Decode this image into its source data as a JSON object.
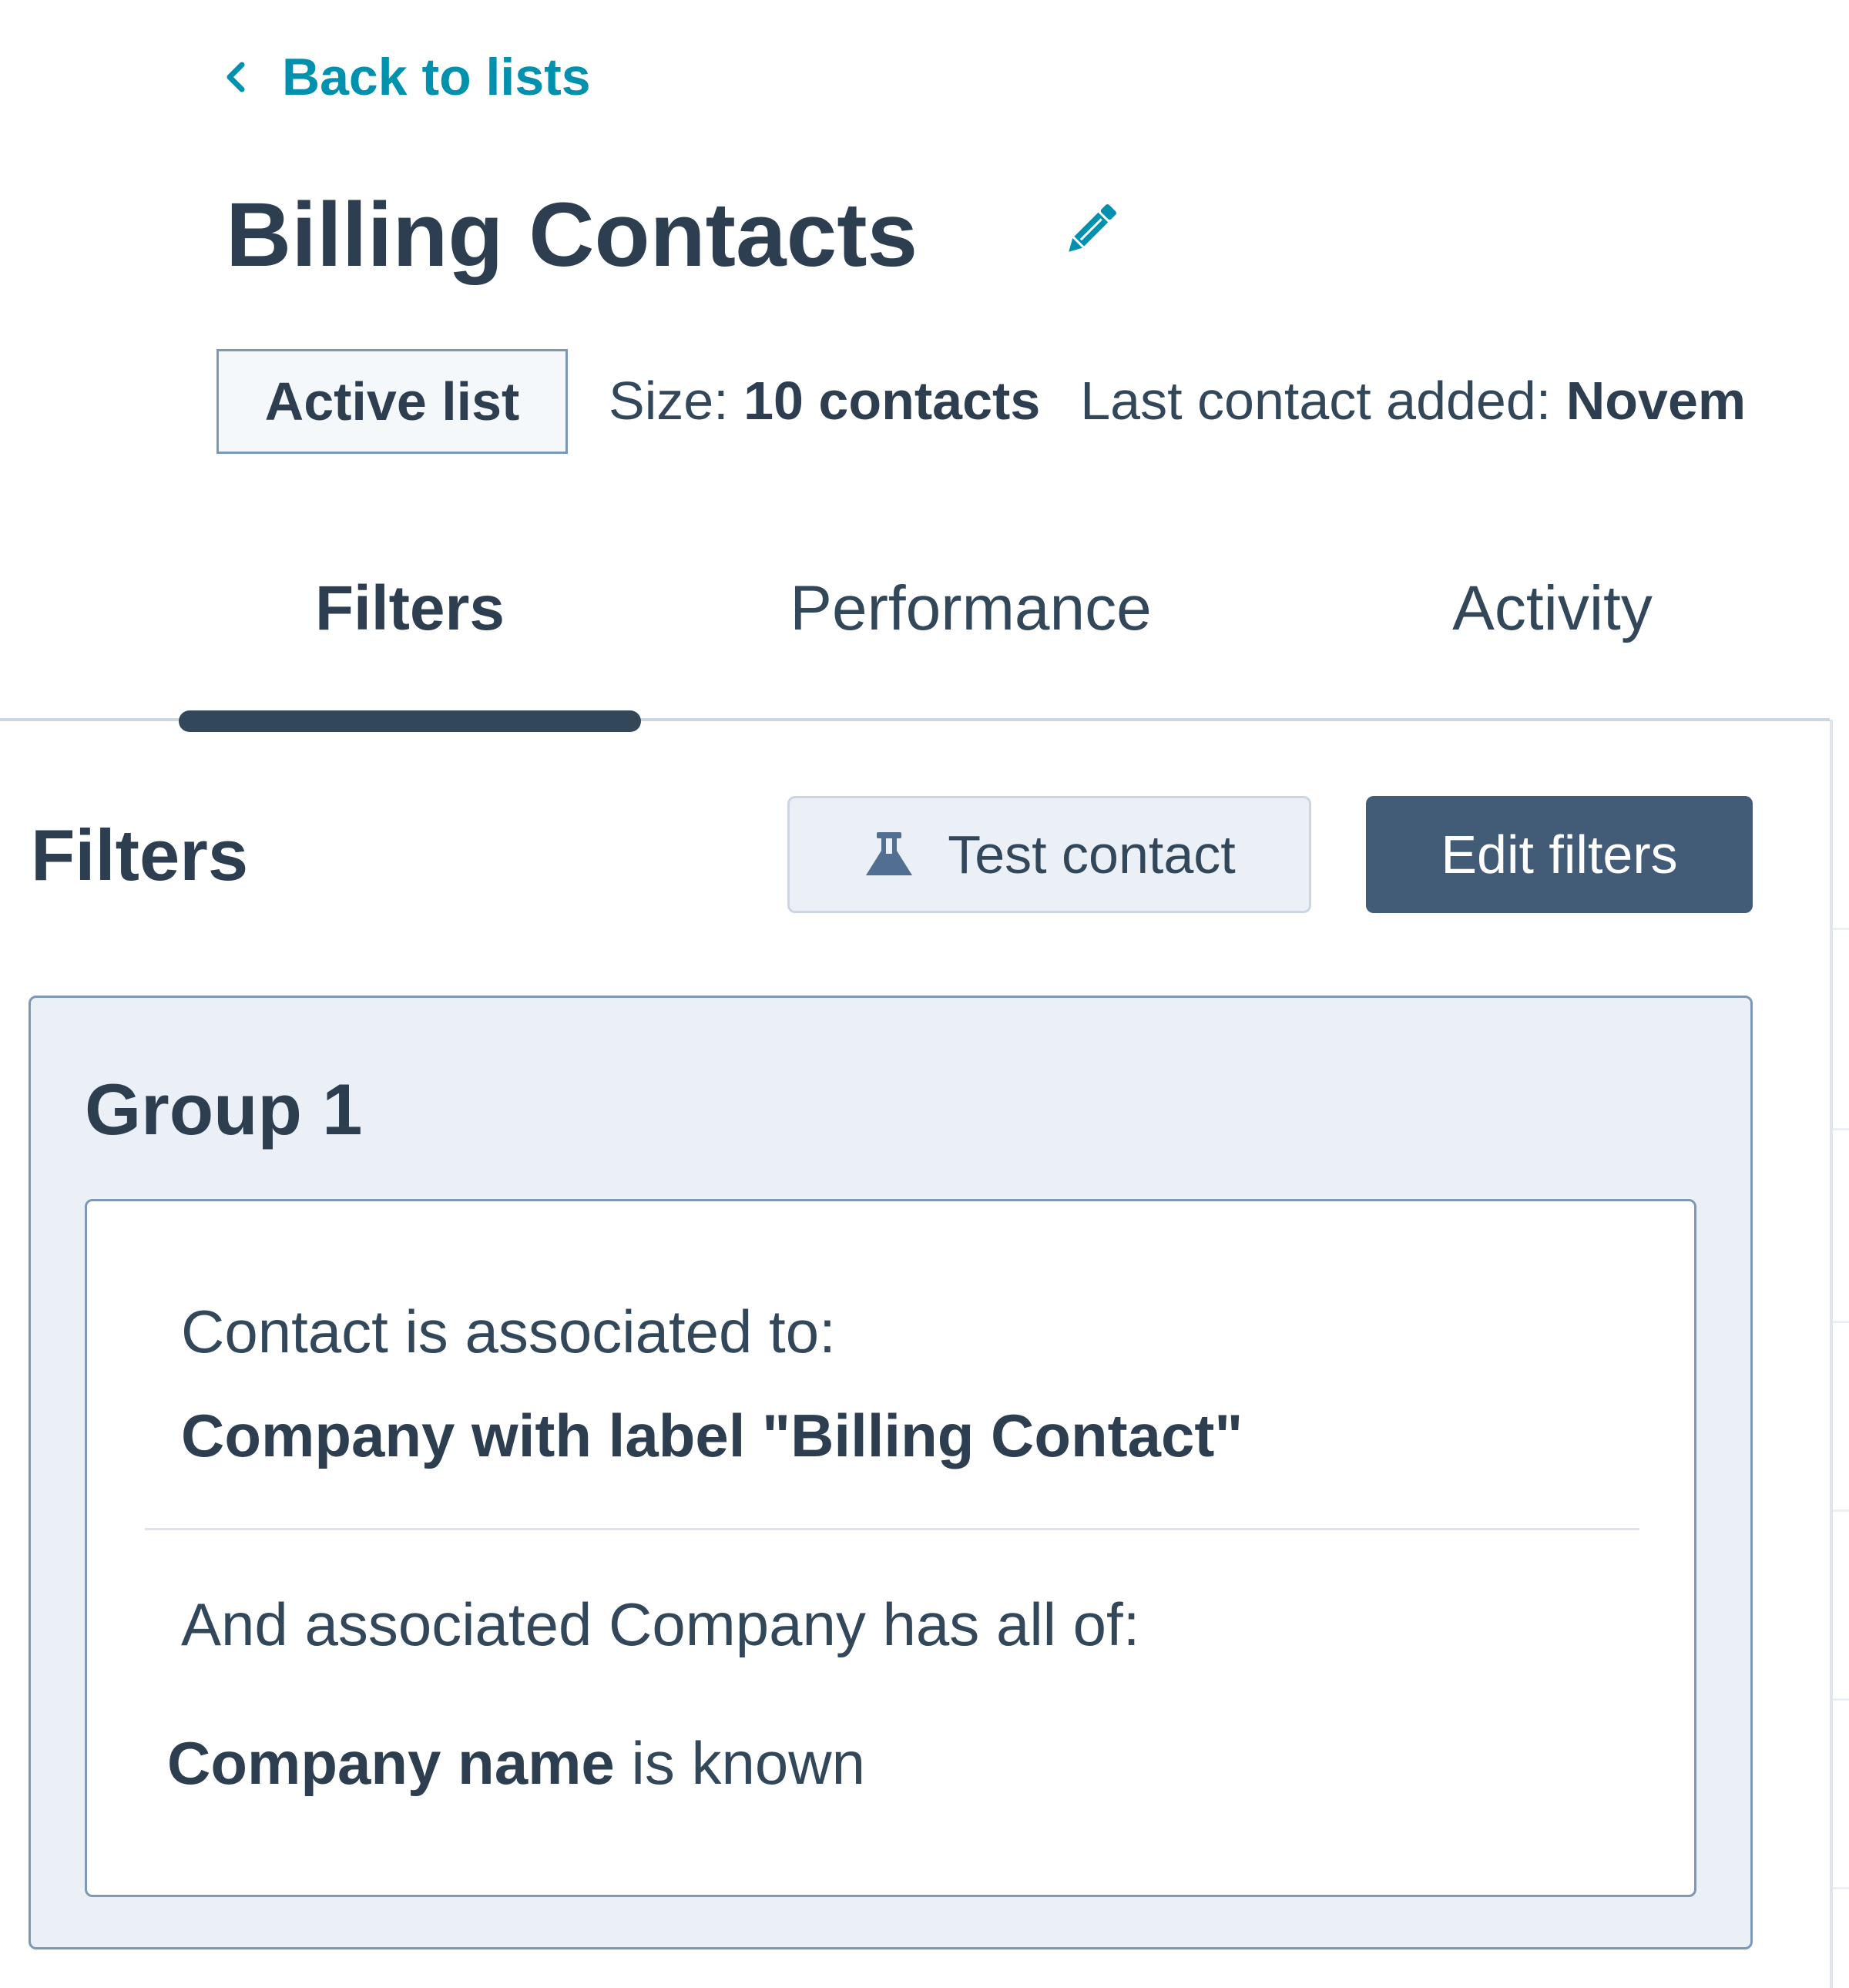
{
  "header": {
    "back_link_label": "Back to lists",
    "title": "Billing Contacts"
  },
  "meta": {
    "list_type": "Active list",
    "size_label": "Size:",
    "size_value": "10 contacts",
    "last_added_label": "Last contact added:",
    "last_added_value": "Novem"
  },
  "tabs": [
    {
      "label": "Filters",
      "active": true
    },
    {
      "label": "Performance",
      "active": false
    },
    {
      "label": "Activity",
      "active": false
    }
  ],
  "filters": {
    "section_title": "Filters",
    "test_contact_label": "Test contact",
    "edit_filters_label": "Edit filters",
    "group": {
      "title": "Group 1",
      "association_intro": "Contact is associated to:",
      "association_target": "Company with label \"Billing Contact\"",
      "condition_intro": "And associated Company has all of:",
      "condition_property": "Company name",
      "condition_operator": "is known"
    }
  },
  "icons": {
    "back": "chevron-left-icon",
    "edit_title": "pencil-icon",
    "test_contact": "flask-icon"
  },
  "colors": {
    "link": "#0091ae",
    "heading": "#2d3e50",
    "text": "#33475b",
    "primary_button": "#425b76",
    "border": "#7c98b6",
    "panel_bg": "#eaf0f6"
  }
}
